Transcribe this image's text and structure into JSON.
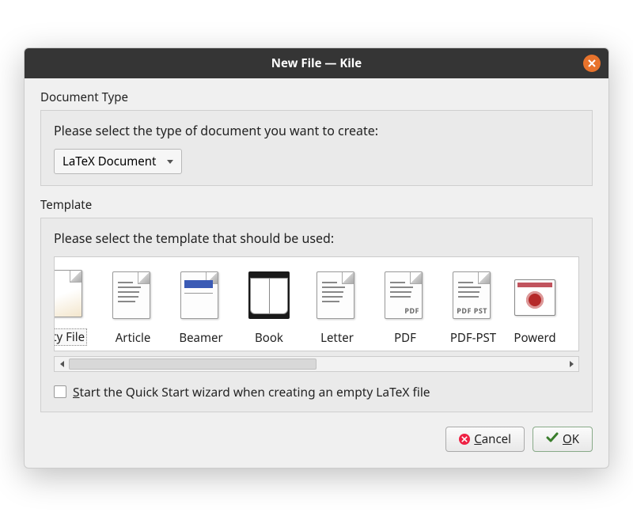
{
  "titlebar": {
    "title": "New File — Kile"
  },
  "section_document_type": {
    "label": "Document Type",
    "prompt": "Please select the type of document you want to create:",
    "combo_value": "LaTeX Document"
  },
  "section_template": {
    "label": "Template",
    "prompt": "Please select the template that should be used:",
    "items": [
      {
        "label": "pty File",
        "icon": "empty-file-icon",
        "selected": true,
        "truncated_left": true
      },
      {
        "label": "Article",
        "icon": "article-icon"
      },
      {
        "label": "Beamer",
        "icon": "beamer-icon"
      },
      {
        "label": "Book",
        "icon": "book-icon"
      },
      {
        "label": "Letter",
        "icon": "letter-icon"
      },
      {
        "label": "PDF",
        "icon": "pdf-icon",
        "badge": "PDF"
      },
      {
        "label": "PDF-PST",
        "icon": "pdf-pst-icon",
        "badge": "PDF PST"
      },
      {
        "label": "Powerd",
        "icon": "powerdot-icon",
        "truncated_right": true
      }
    ],
    "checkbox_label": "Start the Quick Start wizard when creating an empty LaTeX file",
    "checkbox_checked": false
  },
  "buttons": {
    "cancel": "Cancel",
    "ok": "OK"
  }
}
